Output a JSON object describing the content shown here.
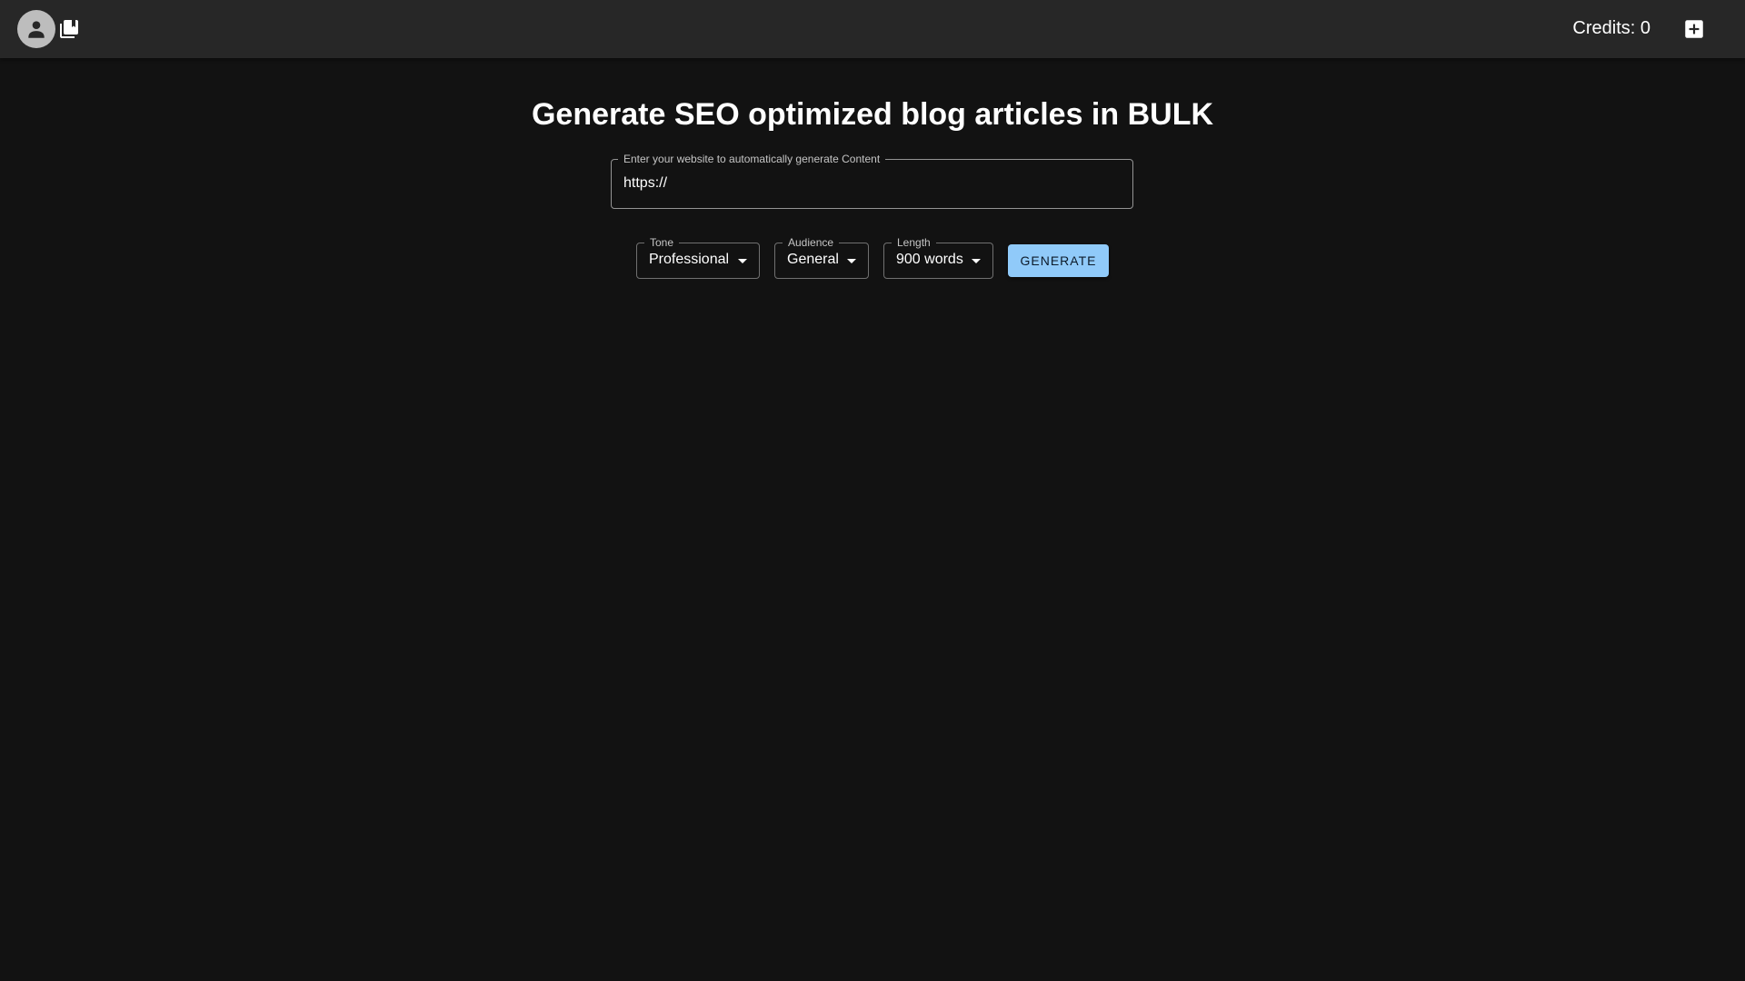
{
  "header": {
    "avatar_icon": "account-circle-icon",
    "library_icon": "library-books-icon",
    "credits_label": "Credits: 0",
    "add_icon": "add-box-icon"
  },
  "main": {
    "title": "Generate SEO optimized blog articles in BULK",
    "website_field": {
      "label": "Enter your website to automatically generate Content",
      "value": "https://"
    },
    "tone": {
      "label": "Tone",
      "value": "Professional"
    },
    "audience": {
      "label": "Audience",
      "value": "General"
    },
    "length": {
      "label": "Length",
      "value": "900 words"
    },
    "generate_label": "GENERATE"
  },
  "colors": {
    "background": "#121212",
    "appbar": "#272727",
    "primary_button": "#90caf9"
  }
}
